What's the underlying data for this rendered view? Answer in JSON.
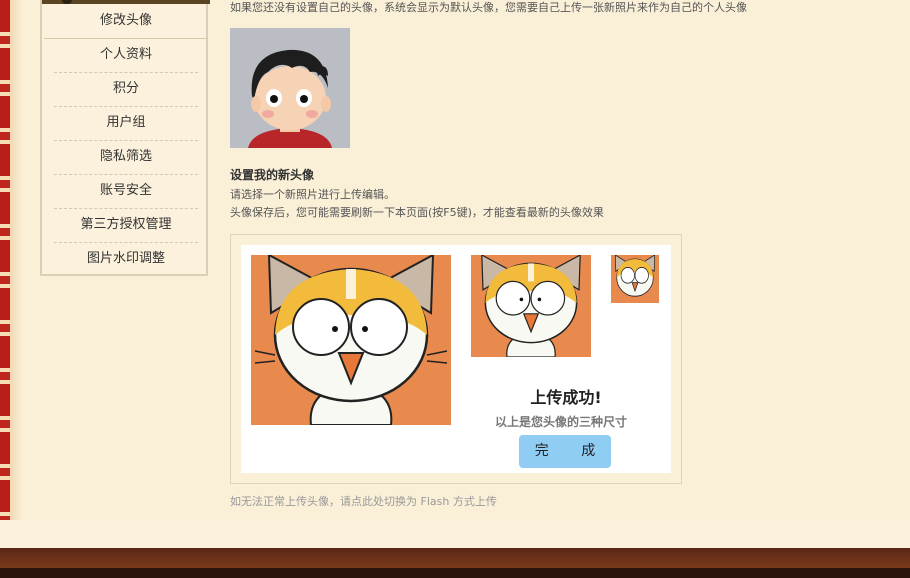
{
  "sidebar": {
    "items": [
      {
        "label": "修改头像",
        "active": true
      },
      {
        "label": "个人资料"
      },
      {
        "label": "积分"
      },
      {
        "label": "用户组"
      },
      {
        "label": "隐私筛选"
      },
      {
        "label": "账号安全"
      },
      {
        "label": "第三方授权管理"
      },
      {
        "label": "图片水印调整"
      }
    ]
  },
  "main": {
    "intro": "如果您还没有设置自己的头像，系统会显示为默认头像，您需要自己上传一张新照片来作为自己的个人头像",
    "section_title": "设置我的新头像",
    "hint_line1": "请选择一个新照片进行上传编辑。",
    "hint_line2": "头像保存后，您可能需要刷新一下本页面(按F5键)，才能查看最新的头像效果",
    "upload": {
      "success_title": "上传成功!",
      "success_sub": "以上是您头像的三种尺寸",
      "done_label": "完 成"
    },
    "flash_link": "如无法正常上传头像，请点此处切换为 Flash 方式上传"
  },
  "colors": {
    "page_bg": "#faf0d8",
    "button_blue": "#8fcdf3",
    "footer_brown": "#5b2815",
    "border_red": "#b91d1a"
  }
}
